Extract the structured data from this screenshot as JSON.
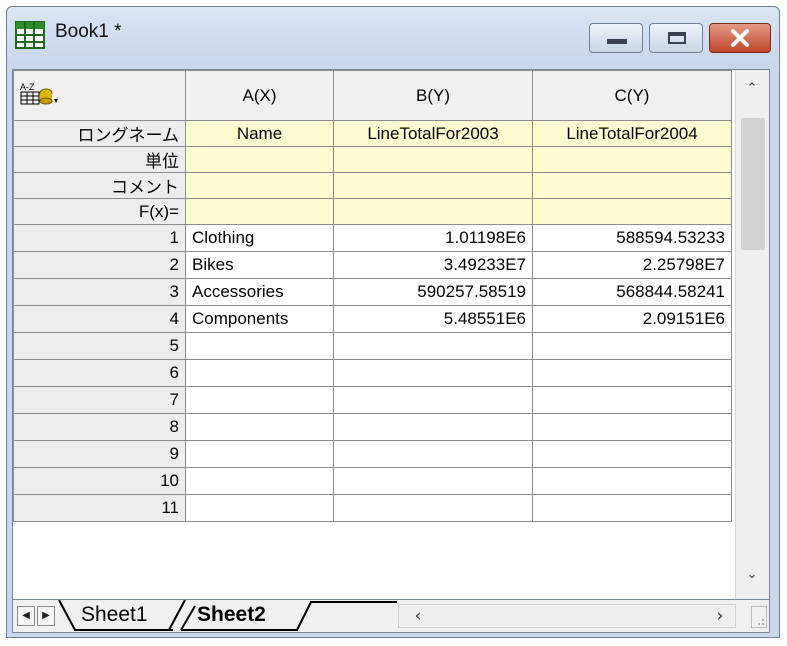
{
  "window": {
    "title": "Book1 *",
    "icon": "worksheet-icon",
    "accent": "#c9d7ea",
    "close_color": "#c0442b"
  },
  "header": {
    "corner_icon": "sort-column-icon",
    "columns": [
      "A(X)",
      "B(Y)",
      "C(Y)"
    ]
  },
  "meta_rows": [
    {
      "label": "ロングネーム",
      "values": [
        "Name",
        "LineTotalFor2003",
        "LineTotalFor2004"
      ]
    },
    {
      "label": "単位",
      "values": [
        "",
        "",
        ""
      ]
    },
    {
      "label": "コメント",
      "values": [
        "",
        "",
        ""
      ]
    },
    {
      "label": "F(x)=",
      "values": [
        "",
        "",
        ""
      ]
    }
  ],
  "rows": [
    {
      "n": "1",
      "a": "Clothing",
      "b": "1.01198E6",
      "c": "588594.53233"
    },
    {
      "n": "2",
      "a": "Bikes",
      "b": "3.49233E7",
      "c": "2.25798E7"
    },
    {
      "n": "3",
      "a": "Accessories",
      "b": "590257.58519",
      "c": "568844.58241"
    },
    {
      "n": "4",
      "a": "Components",
      "b": "5.48551E6",
      "c": "2.09151E6"
    },
    {
      "n": "5",
      "a": "",
      "b": "",
      "c": ""
    },
    {
      "n": "6",
      "a": "",
      "b": "",
      "c": ""
    },
    {
      "n": "7",
      "a": "",
      "b": "",
      "c": ""
    },
    {
      "n": "8",
      "a": "",
      "b": "",
      "c": ""
    },
    {
      "n": "9",
      "a": "",
      "b": "",
      "c": ""
    },
    {
      "n": "10",
      "a": "",
      "b": "",
      "c": ""
    },
    {
      "n": "11",
      "a": "",
      "b": "",
      "c": ""
    }
  ],
  "sheets": {
    "tabs": [
      "Sheet1",
      "Sheet2"
    ],
    "active": "Sheet2"
  },
  "colors": {
    "meta_fill": "#fdfbd0",
    "header_fill": "#f0f0f0"
  }
}
